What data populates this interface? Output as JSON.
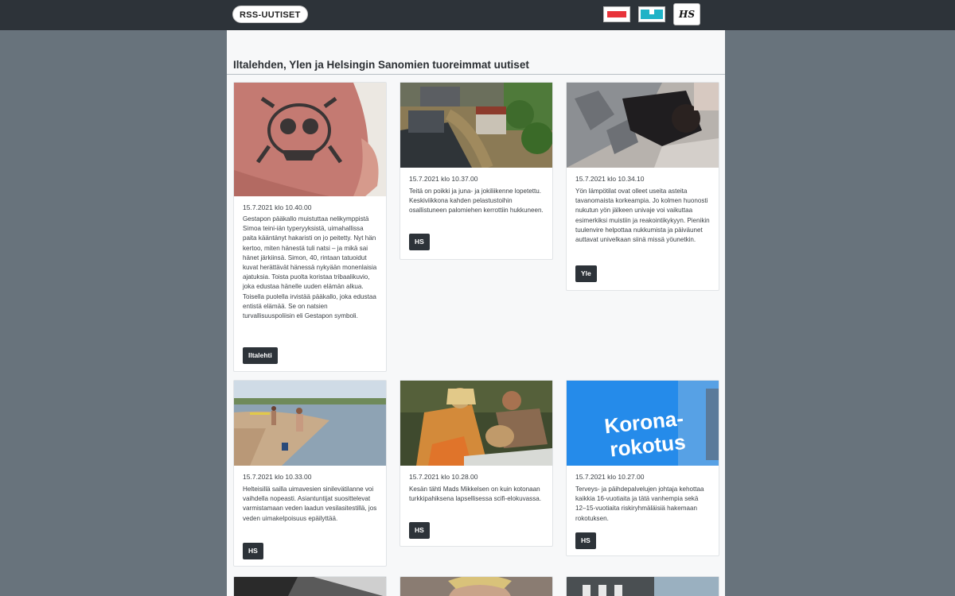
{
  "header": {
    "brand": "RSS-UUTISET",
    "sources": [
      {
        "name": "Iltalehti",
        "icon": "iltalehti-logo-icon",
        "color": "#e8333a"
      },
      {
        "name": "Yle",
        "icon": "yle-logo-icon",
        "color": "#1fb3c7"
      },
      {
        "name": "HS",
        "icon": "hs-logo-icon",
        "label": "HS"
      }
    ]
  },
  "main": {
    "title": "Iltalehden, Ylen ja Helsingin Sanomien tuoreimmat uutiset",
    "cards": [
      {
        "date": "15.7.2021 klo 10.40.00",
        "text": "Gestapon pääkallo muistuttaa nelikymppistä Simoa teini-iän typeryyksistä, uimahallissa paita kääntänyt hakaristi on jo peitetty. Nyt hän kertoo, miten hänestä tuli natsi – ja mikä sai hänet järkiinsä. Simon, 40, rintaan tatuoidut kuvat herättävät hänessä nykyään monenlaisia ajatuksia. Toista puolta koristaa tribaalikuvio, joka edustaa hänelle uuden elämän alkua. Toisella puolella irvistää pääkallo, joka edustaa entistä elämää. Se on natsien turvallisuuspoliisin eli Gestapon symboli.",
        "source": "Iltalehti",
        "image": "skull-tattoo-photo"
      },
      {
        "date": "15.7.2021 klo 10.37.00",
        "text": "Teitä on poikki ja juna- ja jokiliikenne lopetettu. Keskiviikkona kahden pelastustoihin osallistuneen palomiehen kerrottiin hukkuneen.",
        "source": "HS",
        "image": "flooded-town-photo"
      },
      {
        "date": "15.7.2021 klo 10.34.10",
        "text": "Yön lämpötilat ovat olleet useita asteita tavanomaista korkeampia. Jo kolmen huonosti nukutun yön jälkeen univaje voi vaikuttaa esimerkiksi muistiin ja reakointikykyyn. Pienikin tuulenvire helpottaa nukkumista ja päiväunet auttavat univelkaan siinä missä yöunetkin.",
        "source": "Yle",
        "image": "sleeping-person-photo"
      },
      {
        "date": "15.7.2021 klo 10.33.00",
        "text": "Helteisillä sailla uimavesien sinilevätilanne voi vaihdella nopeasti. Asiantuntijat suosittelevat varmistamaan veden laadun vesilasitestillä, jos veden uimakelpoisuus epäilyttää.",
        "source": "HS",
        "image": "beach-photo"
      },
      {
        "date": "15.7.2021 klo 10.28.00",
        "text": "Kesän tähti Mads Mikkelsen on kuin kotonaan turkkipahiksena lapsellisessa scifi-elokuvassa.",
        "source": "HS",
        "image": "film-still-photo"
      },
      {
        "date": "15.7.2021 klo 10.27.00",
        "text": "Terveys- ja päihdepalvelujen johtaja kehottaa kaikkia 16-vuotiaita ja tätä vanhempia sekä 12–15-vuotiaita riskiryhmäläisiä hakemaan rokotuksen.",
        "source": "HS",
        "image": "korona-rokotus-sign-photo",
        "image_text": "Korona-\nrokotus"
      }
    ]
  }
}
